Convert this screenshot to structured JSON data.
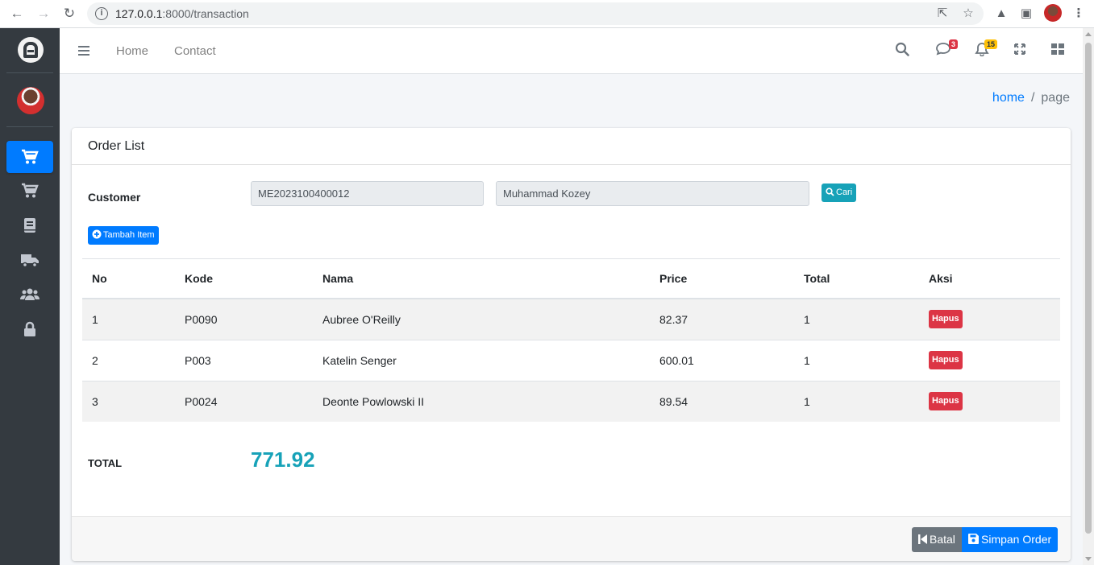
{
  "browser": {
    "url_host": "127.0.0.1",
    "url_rest": ":8000/transaction"
  },
  "navbar": {
    "links": [
      "Home",
      "Contact"
    ],
    "messages_count": "3",
    "notifications_count": "15"
  },
  "breadcrumb": {
    "home": "home",
    "separator": "/",
    "current": "page"
  },
  "card": {
    "title": "Order List",
    "customer_label": "Customer",
    "customer_id": "ME2023100400012",
    "customer_name": "Muhammad Kozey",
    "search_button": "Cari",
    "add_item_button": "Tambah Item"
  },
  "table": {
    "headers": [
      "No",
      "Kode",
      "Nama",
      "Price",
      "Total",
      "Aksi"
    ],
    "rows": [
      {
        "no": "1",
        "kode": "P0090",
        "nama": "Aubree O'Reilly",
        "price": "82.37",
        "total": "1",
        "aksi": "Hapus"
      },
      {
        "no": "2",
        "kode": "P003",
        "nama": "Katelin Senger",
        "price": "600.01",
        "total": "1",
        "aksi": "Hapus"
      },
      {
        "no": "3",
        "kode": "P0024",
        "nama": "Deonte Powlowski II",
        "price": "89.54",
        "total": "1",
        "aksi": "Hapus"
      }
    ]
  },
  "summary": {
    "total_label": "TOTAL",
    "total_value": "771.92"
  },
  "footer": {
    "cancel_button": "Batal",
    "save_button": "Simpan Order"
  },
  "colors": {
    "primary": "#007bff",
    "info": "#17a2b8",
    "danger": "#dc3545",
    "sidebar": "#343a40"
  },
  "icons": [
    "back-arrow-icon",
    "forward-arrow-icon",
    "reload-icon",
    "info-icon",
    "share-icon",
    "star-icon",
    "extension-icon",
    "sidepanel-icon",
    "menu-dots-icon",
    "bars-icon",
    "search-icon",
    "comments-icon",
    "bell-icon",
    "expand-icon",
    "grid-icon",
    "cart-icon",
    "book-icon",
    "truck-icon",
    "users-icon",
    "lock-icon",
    "save-icon",
    "step-backward-icon",
    "plus-circle-icon"
  ]
}
